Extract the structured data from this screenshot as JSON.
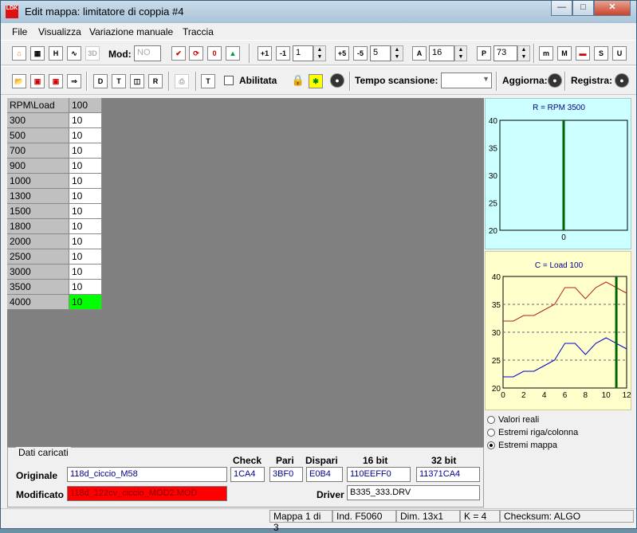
{
  "window": {
    "title": "Edit mappa: limitatore di coppia #4",
    "icon_text": "LDK"
  },
  "menu": [
    "File",
    "Visualizza",
    "Variazione manuale",
    "Traccia"
  ],
  "toolbar1": {
    "mod_label": "Mod:",
    "mod_value": "NO",
    "step1_value": "1",
    "step5_value": "5",
    "a_value": "16",
    "p_value": "73"
  },
  "toolbar2": {
    "abilitata_label": "Abilitata",
    "tempo_label": "Tempo scansione:",
    "aggiorna_label": "Aggiorna:",
    "registra_label": "Registra:"
  },
  "grid": {
    "corner": "RPM\\Load",
    "col_header": "100",
    "rows": [
      {
        "rpm": "300",
        "v": "10"
      },
      {
        "rpm": "500",
        "v": "10"
      },
      {
        "rpm": "700",
        "v": "10"
      },
      {
        "rpm": "900",
        "v": "10"
      },
      {
        "rpm": "1000",
        "v": "10"
      },
      {
        "rpm": "1300",
        "v": "10"
      },
      {
        "rpm": "1500",
        "v": "10"
      },
      {
        "rpm": "1800",
        "v": "10"
      },
      {
        "rpm": "2000",
        "v": "10"
      },
      {
        "rpm": "2500",
        "v": "10"
      },
      {
        "rpm": "3000",
        "v": "10"
      },
      {
        "rpm": "3500",
        "v": "10"
      },
      {
        "rpm": "4000",
        "v": "10"
      }
    ]
  },
  "chart_data": [
    {
      "type": "line",
      "title": "R = RPM 3500",
      "x": [
        0
      ],
      "ylim": [
        20,
        40
      ],
      "yticks": [
        "40",
        "35",
        "30",
        "25",
        "20"
      ],
      "xticks": [
        "0"
      ],
      "marker_x": 0,
      "background": "#ccffff"
    },
    {
      "type": "line",
      "title": "C = Load 100",
      "x": [
        0,
        1,
        2,
        3,
        4,
        5,
        6,
        7,
        8,
        9,
        10,
        11,
        12
      ],
      "series": [
        {
          "values": [
            32,
            32,
            33,
            33,
            34,
            35,
            38,
            38,
            36,
            38,
            39,
            38,
            37
          ],
          "color": "#b22222"
        },
        {
          "values": [
            22,
            22,
            23,
            23,
            24,
            25,
            28,
            28,
            26,
            28,
            29,
            28,
            27
          ],
          "color": "#0000cd"
        }
      ],
      "ylim": [
        20,
        40
      ],
      "xlim": [
        0,
        12
      ],
      "yticks": [
        "40",
        "35",
        "30",
        "25",
        "20"
      ],
      "xticks": [
        "0",
        "2",
        "4",
        "6",
        "8",
        "10",
        "12"
      ],
      "marker_x": 11,
      "grid": true,
      "background": "#ffffcc"
    }
  ],
  "radio_options": [
    {
      "label": "Valori reali",
      "checked": false
    },
    {
      "label": "Estremi riga/colonna",
      "checked": false
    },
    {
      "label": "Estremi mappa",
      "checked": true
    }
  ],
  "dati": {
    "group_label": "Dati caricati",
    "originale_label": "Originale",
    "originale_value": "118d_ciccio_M58",
    "modificato_label": "Modificato",
    "modificato_value": "118d_122cv_ciccio_MOD2.MOD",
    "check_label": "Check",
    "check_value": "1CA4",
    "pari_label": "Pari",
    "pari_value": "3BF0",
    "dispari_label": "Dispari",
    "dispari_value": "E0B4",
    "bit16_label": "16 bit",
    "bit16_value": "110EEFF0",
    "bit32_label": "32 bit",
    "bit32_value": "11371CA4",
    "driver_label": "Driver",
    "driver_value": "B335_333.DRV"
  },
  "status": {
    "mappa": "Mappa 1 di 3",
    "ind": "Ind. F5060",
    "dim": "Dim. 13x1",
    "k": "K = 4",
    "checksum": "Checksum: ALGO"
  }
}
